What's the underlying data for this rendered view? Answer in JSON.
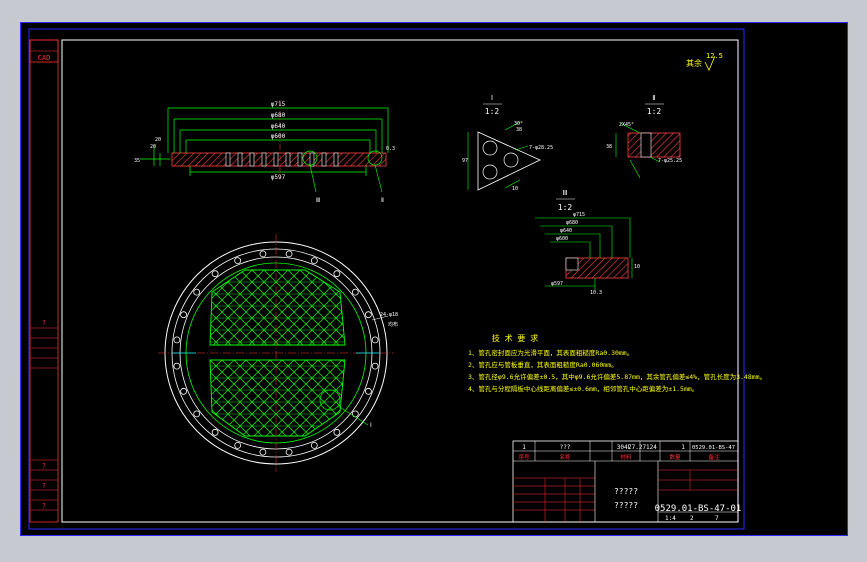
{
  "colors": {
    "background": "#000000",
    "viewport_bg": "#c6cad0",
    "frame": "#ffffff",
    "sheet_border": "#2a2aff",
    "yellow": "#ffff00",
    "green": "#00ff00",
    "red": "#ff3030",
    "white": "#ffffff",
    "cyan": "#00ffff",
    "hatch": "#ff4040"
  },
  "side_strip": {
    "top_label": "CAD",
    "mid_label": "?",
    "bottom_labels": [
      "?",
      "?",
      "?"
    ]
  },
  "surface_note": {
    "label": "其余",
    "roughness": "12.5"
  },
  "section_views": {
    "main": {
      "dims": [
        "φ715",
        "φ680",
        "φ640",
        "φ600",
        "φ597"
      ],
      "side_dims": [
        "20",
        "20",
        "35",
        "0.3"
      ],
      "callouts": [
        "Ⅲ",
        "Ⅱ"
      ]
    },
    "view_I": {
      "label": "Ⅰ",
      "scale": "1:2",
      "dims": [
        "7-φ28.25",
        "97",
        "10",
        "38"
      ],
      "angle": "30°"
    },
    "view_II": {
      "label": "Ⅱ",
      "scale": "1:2",
      "dims": [
        "2X45°",
        "38",
        "7-φ25.25"
      ]
    },
    "view_III": {
      "label": "Ⅲ",
      "scale": "1:2",
      "dims": [
        "φ715",
        "φ680",
        "φ640",
        "φ600",
        "φ597",
        "10",
        "10.3"
      ]
    }
  },
  "plan_view": {
    "hole_note": "24-φ18",
    "hole_note2": "均布",
    "callout": "Ⅰ"
  },
  "tech_requirements": {
    "title": "技 术 要 求",
    "items": [
      "1、管孔密封面应为光滑平面，其表面粗糙度Ra0.30mm。",
      "2、管孔应与管板垂直，其表面粗糙度Ra0.060mm。",
      "3、管孔径φ9.6允许偏差±0.5，其中φ9.6允许偏差5.87mm，其余管孔偏差≤4%，管孔长度为3.48mm。",
      "4、管孔与分程隔板中心线距离偏差≤±0.6mm，相邻管孔中心距偏差为±1.5mm。"
    ]
  },
  "title_block": {
    "parts_row": [
      "1",
      "???",
      "304L",
      "77.27124",
      "1",
      "0529.01-BS-47"
    ],
    "header_row": [
      "序号",
      "名称",
      "材料",
      "数量",
      "备注"
    ],
    "center_text1": "?????",
    "center_text2": "?????",
    "drawing_number": "0529.01-BS-47-01",
    "scale": "1:4",
    "sheet": "2",
    "sheets": "7"
  }
}
